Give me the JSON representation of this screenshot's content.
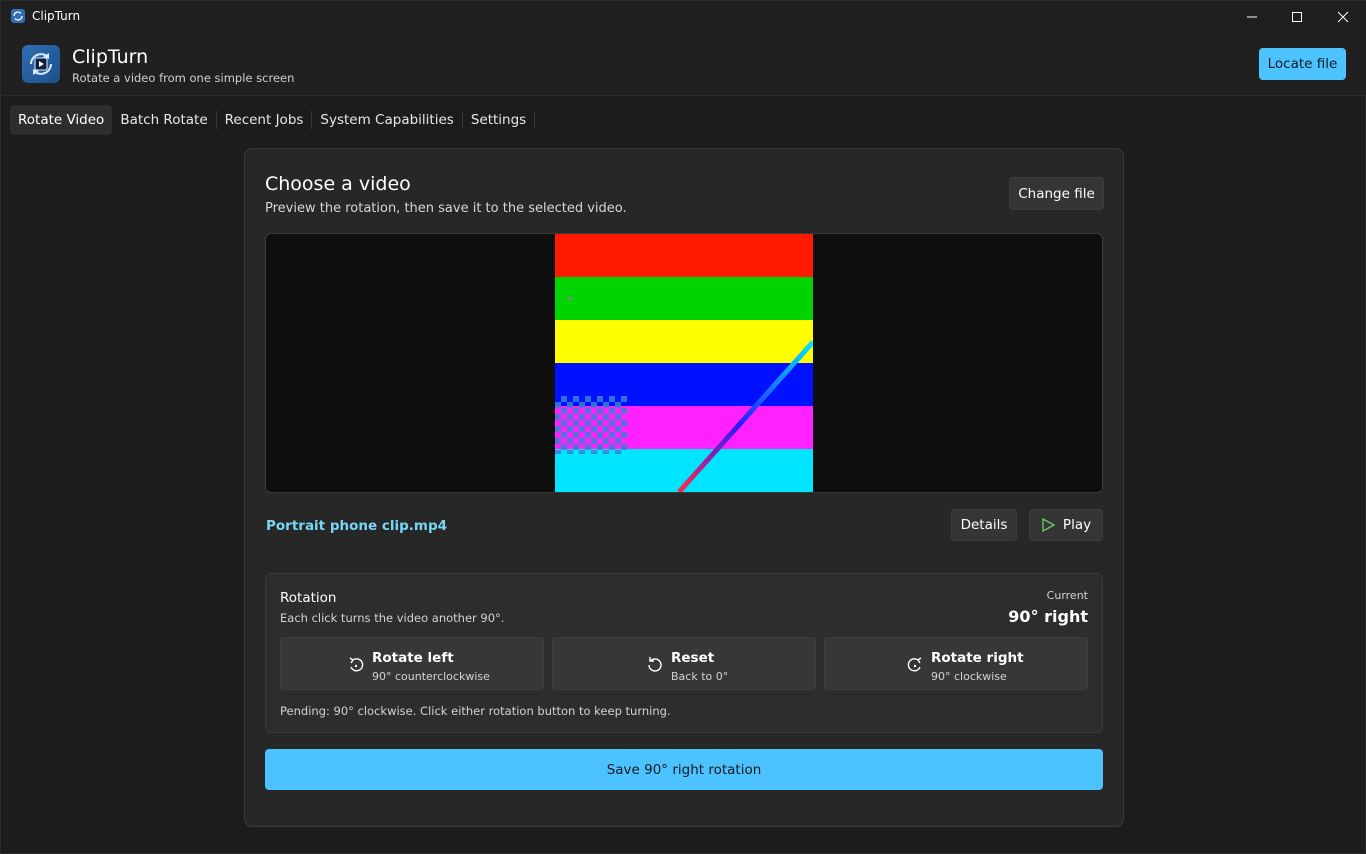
{
  "window": {
    "title": "ClipTurn"
  },
  "header": {
    "app_name": "ClipTurn",
    "tagline": "Rotate a video from one simple screen",
    "locate_label": "Locate file",
    "accent": "#4cc2ff"
  },
  "tabs": [
    {
      "label": "Rotate Video",
      "active": true
    },
    {
      "label": "Batch Rotate",
      "active": false
    },
    {
      "label": "Recent Jobs",
      "active": false
    },
    {
      "label": "System Capabilities",
      "active": false
    },
    {
      "label": "Settings",
      "active": false
    }
  ],
  "card": {
    "title": "Choose a video",
    "subtitle": "Preview the rotation, then save it to the selected video.",
    "change_label": "Change file"
  },
  "preview": {
    "stripe_colors": [
      "#ff1a00",
      "#00d400",
      "#ffff00",
      "#0011ff",
      "#ff22ff",
      "#00e5ff"
    ]
  },
  "file": {
    "name": "Portrait phone clip.mp4",
    "details_label": "Details",
    "play_label": "Play"
  },
  "rotation": {
    "title": "Rotation",
    "subtitle": "Each click turns the video another 90°.",
    "current_label": "Current",
    "current_value": "90° right",
    "left": {
      "label": "Rotate left",
      "sub": "90° counterclockwise"
    },
    "reset": {
      "label": "Reset",
      "sub": "Back to 0°"
    },
    "right": {
      "label": "Rotate right",
      "sub": "90° clockwise"
    },
    "pending": "Pending: 90° clockwise. Click either rotation button to keep turning."
  },
  "save_label": "Save 90° right rotation"
}
